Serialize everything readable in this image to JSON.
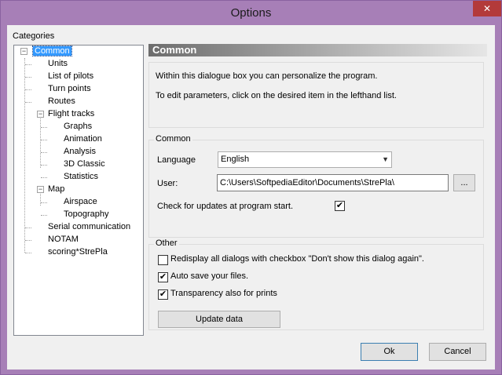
{
  "window": {
    "title": "Options",
    "close_glyph": "✕"
  },
  "categories_label": "Categories",
  "tree": {
    "items": [
      {
        "label": "Common",
        "selected": true,
        "expander": "−"
      },
      {
        "label": "Units"
      },
      {
        "label": "List of pilots"
      },
      {
        "label": "Turn points"
      },
      {
        "label": "Routes"
      },
      {
        "label": "Flight tracks",
        "expander": "−"
      },
      {
        "label": "Graphs"
      },
      {
        "label": "Animation"
      },
      {
        "label": "Analysis"
      },
      {
        "label": "3D Classic"
      },
      {
        "label": "Statistics"
      },
      {
        "label": "Map",
        "expander": "−"
      },
      {
        "label": "Airspace"
      },
      {
        "label": "Topography"
      },
      {
        "label": "Serial communication"
      },
      {
        "label": "NOTAM"
      },
      {
        "label": "scoring*StrePla"
      }
    ]
  },
  "panel": {
    "header": "Common",
    "info_line1": "Within this dialogue box you can personalize the program.",
    "info_line2": "To edit parameters, click on the desired item in the lefthand list.",
    "common_group": {
      "legend": "Common",
      "language_label": "Language",
      "language_value": "English",
      "user_label": "User:",
      "user_value": "C:\\Users\\SoftpediaEditor\\Documents\\StrePla\\",
      "browse_label": "...",
      "updates_label": "Check for updates at program start.",
      "updates_checked": true
    },
    "other_group": {
      "legend": "Other",
      "redisplay_label": "Redisplay all dialogs with checkbox \"Don't show this dialog again\".",
      "redisplay_checked": false,
      "autosave_label": "Auto save your files.",
      "autosave_checked": true,
      "transparency_label": "Transparency also for prints",
      "transparency_checked": true,
      "update_button": "Update data"
    }
  },
  "footer": {
    "ok_label": "Ok",
    "cancel_label": "Cancel"
  },
  "check_glyph": "✔"
}
